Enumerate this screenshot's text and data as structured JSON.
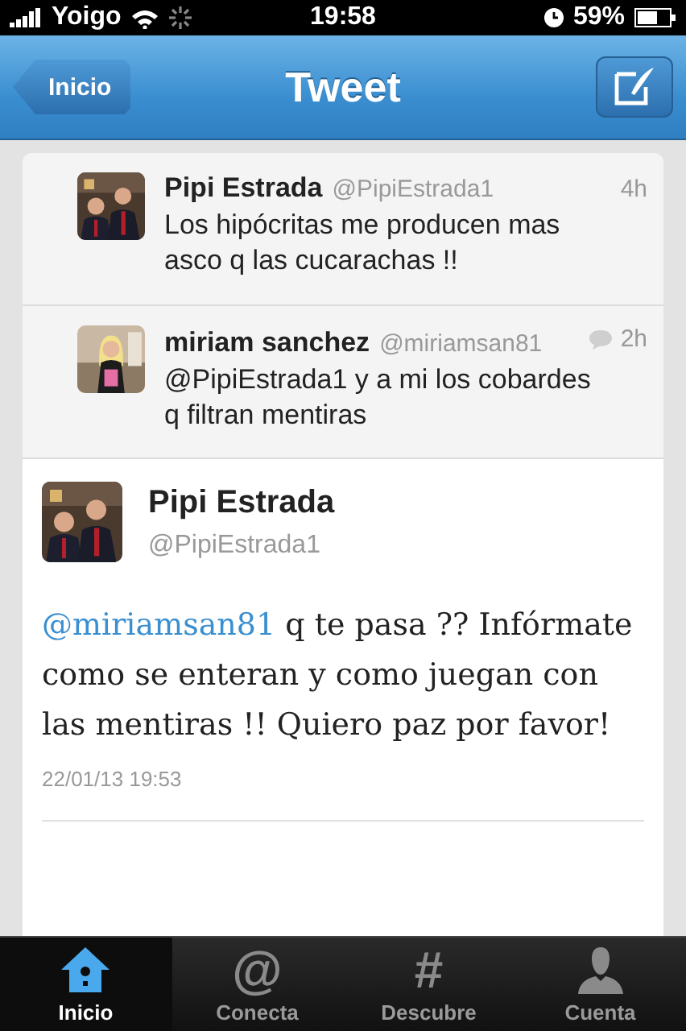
{
  "status_bar": {
    "carrier": "Yoigo",
    "time": "19:58",
    "battery": "59%"
  },
  "nav_bar": {
    "back": "Inicio",
    "title": "Tweet"
  },
  "replies": [
    {
      "name": "Pipi Estrada",
      "handle": "@PipiEstrada1",
      "time": "4h",
      "reply_icon": false,
      "text": "Los hipócritas me producen mas asco q las cucarachas !!"
    },
    {
      "name": "miriam sanchez",
      "handle": "@miriamsan81",
      "time": "2h",
      "reply_icon": true,
      "text": "@PipiEstrada1 y a mi los cobardes q filtran mentiras"
    }
  ],
  "tweet": {
    "name": "Pipi Estrada",
    "handle": "@PipiEstrada1",
    "mention": "@miriamsan81",
    "text": " q te pasa ?? Infórmate como se enteran y como juegan con las mentiras !! Quiero paz por favor!",
    "date": "22/01/13 19:53"
  },
  "tab_bar": [
    {
      "kind": "home",
      "label": "Inicio",
      "selected": true
    },
    {
      "kind": "glyph",
      "icon": "@",
      "label": "Conecta",
      "selected": false
    },
    {
      "kind": "glyph",
      "icon": "#",
      "label": "Descubre",
      "selected": false
    },
    {
      "kind": "person",
      "label": "Cuenta",
      "selected": false
    }
  ]
}
